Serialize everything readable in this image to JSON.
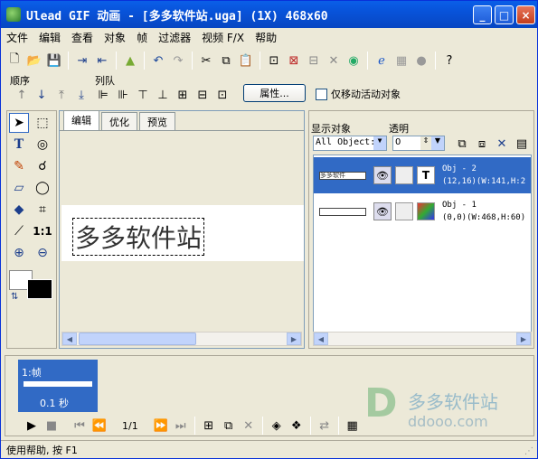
{
  "title": "Ulead GIF 动画 - [多多软件站.uga] (1X) 468x60",
  "window_buttons": {
    "min": "_",
    "max": "□",
    "close": "×"
  },
  "menu": [
    "文件",
    "编辑",
    "查看",
    "对象",
    "帧",
    "过滤器",
    "视频 F/X",
    "帮助"
  ],
  "toolbar_icons": [
    "new-icon",
    "open-icon",
    "save-icon",
    "import-icon",
    "export-icon",
    "optimize-icon",
    "undo-icon",
    "redo-icon",
    "cut-icon",
    "copy-icon",
    "paste-icon",
    "crop-icon",
    "delete-icon",
    "deselect-icon",
    "merge-icon",
    "preview-icon",
    "web-icon",
    "flip-icon",
    "link-icon",
    "help-icon"
  ],
  "labels": {
    "order": "顺序",
    "queue": "列队",
    "properties": "属性...",
    "move_active_only": "仅移动活动对象"
  },
  "editor": {
    "tabs": [
      "编辑",
      "优化",
      "预览"
    ],
    "canvas_text": "多多软件站"
  },
  "objects": {
    "show_label": "显示对象",
    "opacity_label": "透明",
    "show_value": "All Object:",
    "opacity_value": "0",
    "items": [
      {
        "name": "Obj - 2",
        "info": "(12,16)(W:141,H:2",
        "type": "T",
        "selected": true,
        "thumb_text": "多多软件"
      },
      {
        "name": "Obj - 1",
        "info": "(0,0)(W:468,H:60)",
        "type": "img",
        "selected": false
      }
    ]
  },
  "frame_panel": {
    "frames": [
      {
        "label": "1:帧",
        "delay": "0.1 秒"
      }
    ],
    "counter": "1/1"
  },
  "status": "使用帮助, 按 F1",
  "watermark": {
    "cn": "多多软件站",
    "url": "ddooo.com"
  }
}
